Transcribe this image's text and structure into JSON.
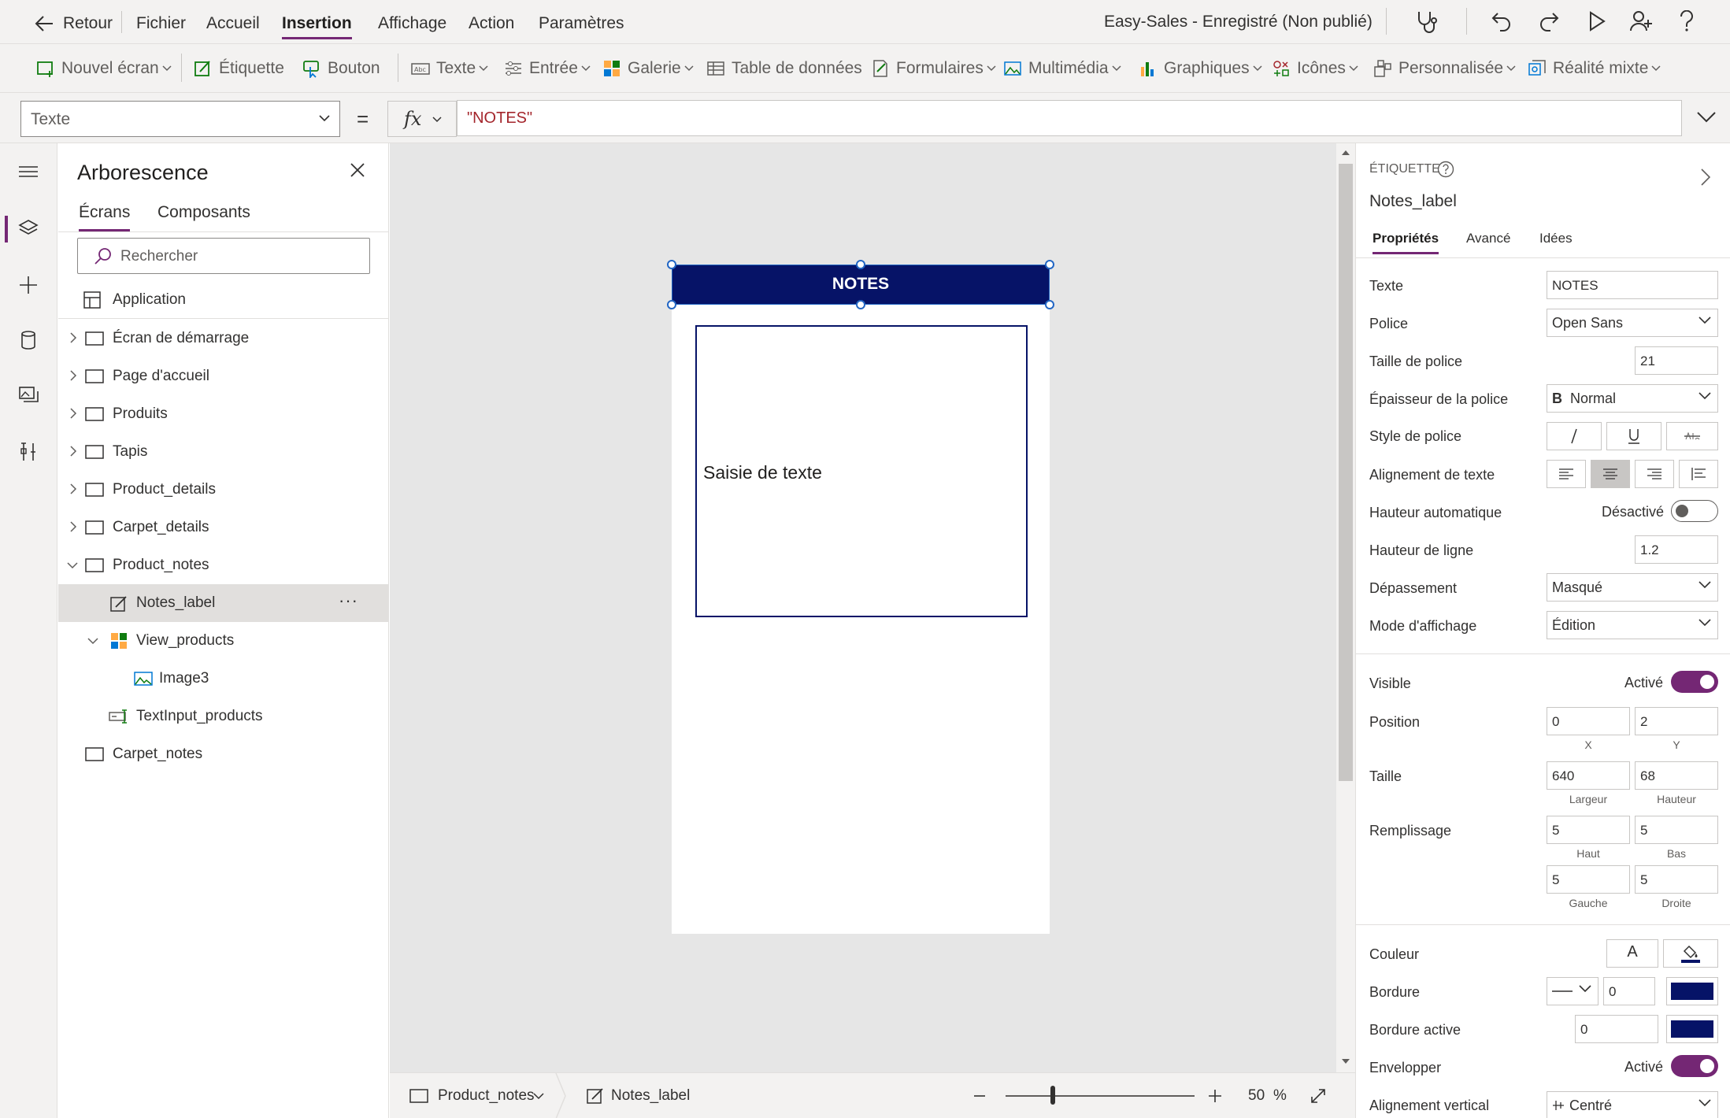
{
  "menu": {
    "back": "Retour",
    "items": [
      "Fichier",
      "Accueil",
      "Insertion",
      "Affichage",
      "Action",
      "Paramètres"
    ],
    "app_title": "Easy-Sales - Enregistré (Non publié)"
  },
  "ribbon": {
    "new_screen": "Nouvel écran",
    "label": "Étiquette",
    "button": "Bouton",
    "text": "Texte",
    "input": "Entrée",
    "gallery": "Galerie",
    "data_table": "Table de données",
    "forms": "Formulaires",
    "media": "Multimédia",
    "charts": "Graphiques",
    "icons": "Icônes",
    "custom": "Personnalisée",
    "mixed_reality": "Réalité mixte"
  },
  "formula": {
    "property": "Texte",
    "equals": "=",
    "fx": "fx",
    "value": "\"NOTES\""
  },
  "tree": {
    "title": "Arborescence",
    "tabs": [
      "Écrans",
      "Composants"
    ],
    "search_placeholder": "Rechercher",
    "app": "Application",
    "screens": [
      "Écran de démarrage",
      "Page d'accueil",
      "Produits",
      "Tapis",
      "Product_details",
      "Carpet_details",
      "Product_notes"
    ],
    "children": {
      "notes_label": "Notes_label",
      "view_products": "View_products",
      "image3": "Image3",
      "text_input": "TextInput_products"
    },
    "last_screen": "Carpet_notes",
    "more": "···"
  },
  "canvas": {
    "header_text": "NOTES",
    "input_placeholder": "Saisie de texte"
  },
  "status": {
    "screen": "Product_notes",
    "control": "Notes_label",
    "zoom_value": "50",
    "zoom_unit": "%",
    "zoom_level": 0.5
  },
  "props": {
    "type": "ÉTIQUETTE",
    "name": "Notes_label",
    "tabs": [
      "Propriétés",
      "Avancé",
      "Idées"
    ],
    "text_label": "Texte",
    "text_value": "NOTES",
    "font_label": "Police",
    "font_value": "Open Sans",
    "size_label": "Taille de police",
    "size_value": "21",
    "weight_label": "Épaisseur de la police",
    "weight_value": "Normal",
    "weight_glyph": "B",
    "style_label": "Style de police",
    "align_label": "Alignement de texte",
    "autoheight_label": "Hauteur automatique",
    "autoheight_state": "Désactivé",
    "lineheight_label": "Hauteur de ligne",
    "lineheight_value": "1.2",
    "overflow_label": "Dépassement",
    "overflow_value": "Masqué",
    "displaymode_label": "Mode d'affichage",
    "displaymode_value": "Édition",
    "visible_label": "Visible",
    "visible_state": "Activé",
    "position_label": "Position",
    "x": "0",
    "y": "2",
    "x_cap": "X",
    "y_cap": "Y",
    "size2_label": "Taille",
    "width": "640",
    "height": "68",
    "width_cap": "Largeur",
    "height_cap": "Hauteur",
    "padding_label": "Remplissage",
    "pad_top": "5",
    "pad_bottom": "5",
    "pad_left": "5",
    "pad_right": "5",
    "pad_top_cap": "Haut",
    "pad_bottom_cap": "Bas",
    "pad_left_cap": "Gauche",
    "pad_right_cap": "Droite",
    "color_label": "Couleur",
    "color_glyph": "A",
    "border_label": "Bordure",
    "border_value": "0",
    "focusborder_label": "Bordure active",
    "focusborder_value": "0",
    "wrap_label": "Envelopper",
    "wrap_state": "Activé",
    "valign_label": "Alignement vertical",
    "valign_value": "Centré"
  },
  "colors": {
    "accent": "#742774",
    "header_fill": "#061367",
    "border_swatch": "#061367"
  }
}
